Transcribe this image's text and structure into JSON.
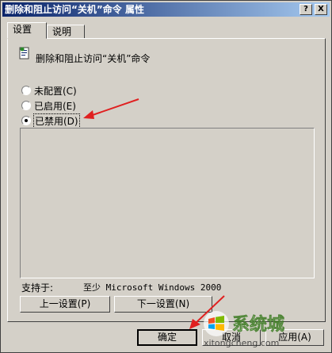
{
  "window": {
    "title": "删除和阻止访问“关机”命令 属性",
    "help_button": "?",
    "close_button": "X"
  },
  "tabs": [
    {
      "label": "设置",
      "active": true
    },
    {
      "label": "说明",
      "active": false
    }
  ],
  "policy": {
    "icon": "policy-icon",
    "title": "删除和阻止访问“关机”命令"
  },
  "options": [
    {
      "label": "未配置(C)",
      "checked": false
    },
    {
      "label": "已启用(E)",
      "checked": false
    },
    {
      "label": "已禁用(D)",
      "checked": true
    }
  ],
  "supported": {
    "label": "支持于:",
    "value": "至少 Microsoft Windows 2000"
  },
  "nav_buttons": {
    "prev": "上一设置(P)",
    "next": "下一设置(N)"
  },
  "dialog_buttons": {
    "ok": "确定",
    "cancel": "取消",
    "apply": "应用(A)"
  },
  "watermark": {
    "brand": "系统城",
    "site": "xitongcheng.com"
  },
  "colors": {
    "titlebar_start": "#0a246a",
    "titlebar_end": "#a6caf0",
    "face": "#d4d0c8",
    "annotation_arrow": "#e02020"
  }
}
